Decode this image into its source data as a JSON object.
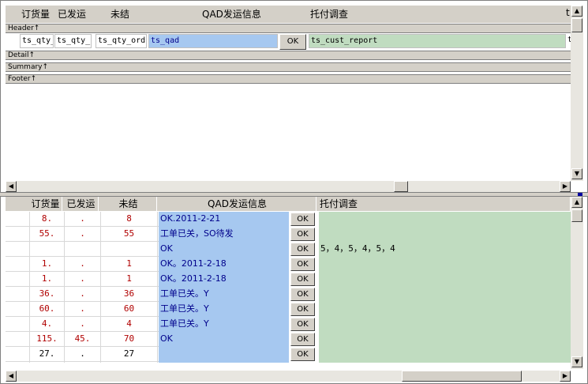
{
  "design": {
    "headers": [
      "订货量",
      "已发运",
      "未结",
      "QAD发运信息",
      "托付调查",
      "t"
    ],
    "bands": {
      "header": "Header↑",
      "detail": "Detail↑",
      "summary": "Summary↑",
      "footer": "Footer↑"
    },
    "fields": [
      "ts_qty_",
      "ts_qty_s",
      "ts_qty_ord",
      "ts_qad",
      "ts_cust_report",
      "t"
    ],
    "ok_label": "OK"
  },
  "grid": {
    "headers": [
      "订货量",
      "已发运",
      "未结",
      "QAD发运信息",
      "托付调查"
    ],
    "rows": [
      {
        "qty": "8.",
        "shipped": ".",
        "open": "8",
        "qad": "OK.2011-2-21",
        "cust": ""
      },
      {
        "qty": "55.",
        "shipped": ".",
        "open": "55",
        "qad": "工单已关，SO待发",
        "cust": ""
      },
      {
        "qty": "",
        "shipped": "",
        "open": "",
        "qad": "OK",
        "cust": "5，4，5，4，5，4"
      },
      {
        "qty": "1.",
        "shipped": ".",
        "open": "1",
        "qad": "OK。2011-2-18",
        "cust": ""
      },
      {
        "qty": "1.",
        "shipped": ".",
        "open": "1",
        "qad": "OK。2011-2-18",
        "cust": ""
      },
      {
        "qty": "36.",
        "shipped": ".",
        "open": "36",
        "qad": "工单已关。Y",
        "cust": ""
      },
      {
        "qty": "60.",
        "shipped": ".",
        "open": "60",
        "qad": "工单已关。Y",
        "cust": ""
      },
      {
        "qty": "4.",
        "shipped": ".",
        "open": "4",
        "qad": "工单已关。Y",
        "cust": ""
      },
      {
        "qty": "115.",
        "shipped": "45.",
        "open": "70",
        "qad": "OK",
        "cust": ""
      },
      {
        "qty": "27.",
        "shipped": ".",
        "open": "27",
        "qad": "",
        "cust": ""
      }
    ],
    "ok_label": "OK"
  },
  "colors": {
    "qad_bg": "#a6c8f0",
    "cust_bg": "#c0dcc0",
    "red_text": "#b00000",
    "qad_text": "#00008b"
  },
  "icons": {
    "up": "arrow-up-icon",
    "down": "arrow-down-icon",
    "left": "arrow-left-icon",
    "right": "arrow-right-icon"
  }
}
